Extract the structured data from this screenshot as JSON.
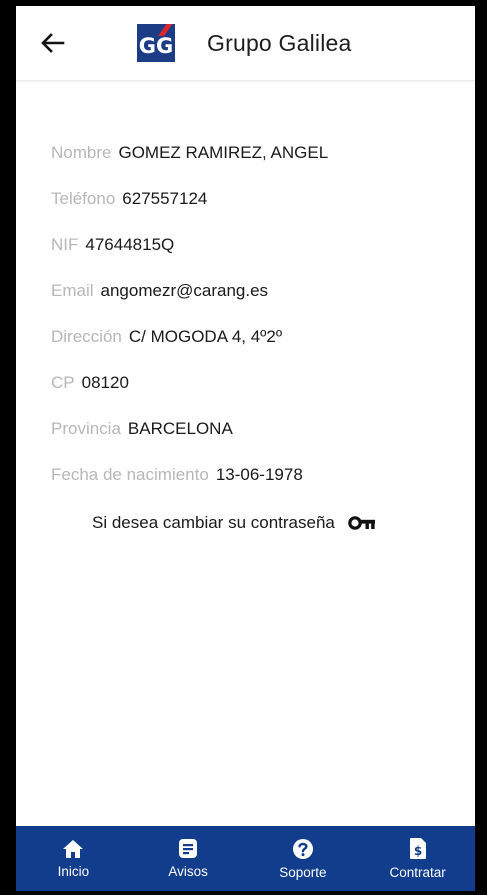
{
  "header": {
    "logo_text": "GG",
    "title": "Grupo Galilea"
  },
  "profile": {
    "fields": [
      {
        "label": "Nombre",
        "value": "GOMEZ RAMIREZ, ANGEL"
      },
      {
        "label": "Teléfono",
        "value": "627557124"
      },
      {
        "label": "NIF",
        "value": "47644815Q"
      },
      {
        "label": "Email",
        "value": "angomezr@carang.es"
      },
      {
        "label": "Dirección",
        "value": "C/ MOGODA 4, 4º2º"
      },
      {
        "label": "CP",
        "value": "08120"
      },
      {
        "label": "Provincia",
        "value": "BARCELONA"
      },
      {
        "label": "Fecha de nacimiento",
        "value": "13-06-1978"
      }
    ],
    "password_link": "Si desea cambiar su contraseña"
  },
  "bottom_nav": {
    "items": [
      {
        "label": "Inicio",
        "icon": "home-icon"
      },
      {
        "label": "Avisos",
        "icon": "notice-icon"
      },
      {
        "label": "Soporte",
        "icon": "help-icon"
      },
      {
        "label": "Contratar",
        "icon": "contract-icon"
      }
    ]
  },
  "colors": {
    "brand_blue": "#123c8c",
    "logo_blue": "#1c3d86",
    "logo_accent_red": "#d9262b",
    "label_gray": "#b7b7b7"
  }
}
